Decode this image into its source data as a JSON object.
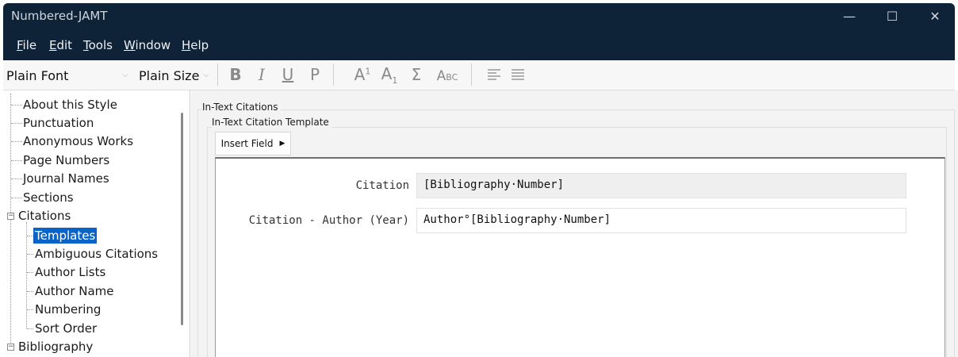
{
  "window": {
    "title": "Numbered-JAMT",
    "minimize_glyph": "—",
    "maximize_glyph": "☐",
    "close_glyph": "✕"
  },
  "menu": {
    "items": [
      {
        "label": "File",
        "accel": "F",
        "rest": "ile"
      },
      {
        "label": "Edit",
        "accel": "E",
        "rest": "dit"
      },
      {
        "label": "Tools",
        "accel": "T",
        "rest": "ools"
      },
      {
        "label": "Window",
        "accel": "W",
        "rest": "indow"
      },
      {
        "label": "Help",
        "accel": "H",
        "rest": "elp"
      }
    ]
  },
  "toolbar": {
    "font_value": "Plain Font",
    "size_value": "Plain Size",
    "bold": "B",
    "italic": "I",
    "underline": "U",
    "plain": "P",
    "superscript_base": "A",
    "superscript_mark": "1",
    "subscript_base": "A",
    "subscript_mark": "1",
    "symbol": "Σ",
    "smallcaps_big": "A",
    "smallcaps_small": "BC"
  },
  "sidebar": {
    "items": [
      {
        "label": "About this Style"
      },
      {
        "label": "Punctuation"
      },
      {
        "label": "Anonymous Works"
      },
      {
        "label": "Page Numbers"
      },
      {
        "label": "Journal Names"
      },
      {
        "label": "Sections"
      },
      {
        "label": "Citations",
        "expanded": true
      },
      {
        "label": "Templates",
        "selected": true
      },
      {
        "label": "Ambiguous Citations"
      },
      {
        "label": "Author Lists"
      },
      {
        "label": "Author Name"
      },
      {
        "label": "Numbering"
      },
      {
        "label": "Sort Order"
      },
      {
        "label": "Bibliography",
        "expanded": true
      }
    ]
  },
  "main": {
    "section_title": "In-Text Citations",
    "template_title": "In-Text Citation Template",
    "insert_field_label": "Insert Field",
    "fields": [
      {
        "label": "Citation",
        "value": "[Bibliography·Number]"
      },
      {
        "label": "Citation - Author (Year)",
        "value": "Author°[Bibliography·Number]"
      }
    ]
  }
}
